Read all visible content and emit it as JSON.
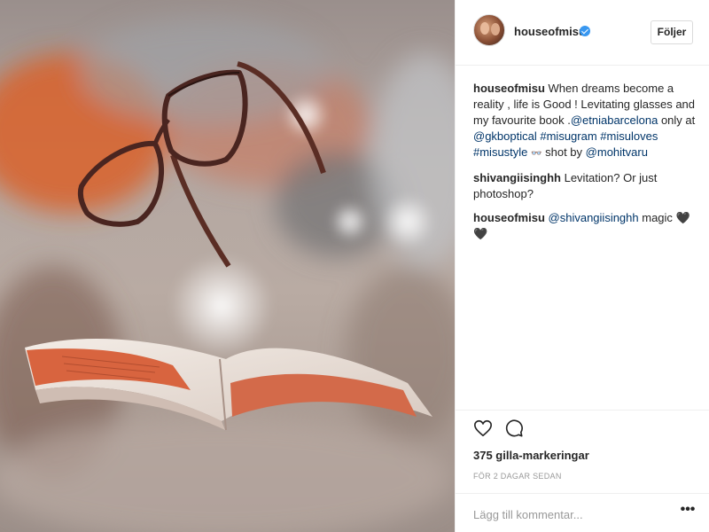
{
  "post": {
    "author": "houseofmisu",
    "follow_label": "Följer",
    "verified": true
  },
  "caption": {
    "user": "houseofmisu",
    "text_1": "When dreams become a reality , life is Good ! Levitating glasses and my favourite book .",
    "tag_brand": "@etniabarcelona",
    "text_2": "only at",
    "tag_shop": "@gkboptical",
    "hashtag_1": "#misugram",
    "hashtag_2": "#misuloves",
    "hashtag_3": "#misustyle",
    "emoji": "👓",
    "text_3": "shot by",
    "tag_photographer": "@mohitvaru"
  },
  "comments": [
    {
      "user": "shivangiisinghh",
      "text": "Levitation? Or just photoshop?"
    },
    {
      "user": "houseofmisu",
      "mention": "@shivangiisinghh",
      "text": "magic",
      "emoji": "🖤🖤"
    }
  ],
  "likes_text": "375 gilla-markeringar",
  "timestamp": "FÖR 2 DAGAR SEDAN",
  "add_comment_placeholder": "Lägg till kommentar...",
  "more_label": "•••",
  "icons": {
    "like": "heart-icon",
    "comment": "comment-icon",
    "verified": "verified-badge-icon",
    "more": "more-options-icon"
  },
  "colors": {
    "link": "#003569",
    "verified": "#3897f0",
    "muted": "#999999",
    "text": "#262626"
  }
}
